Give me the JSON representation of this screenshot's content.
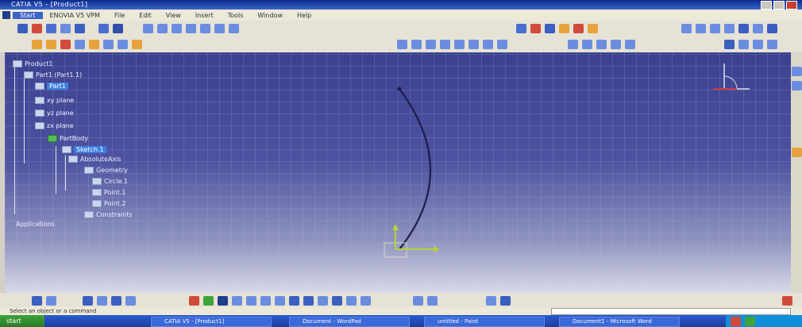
{
  "window": {
    "title": "CATIA V5 - [Product1]"
  },
  "menu": [
    "Start",
    "ENOVIA V5 VPM",
    "File",
    "Edit",
    "View",
    "Insert",
    "Tools",
    "Window",
    "Help"
  ],
  "tree": [
    {
      "label": "Product1",
      "icon": "product-icon"
    },
    {
      "label": "Part1 (Part1.1)",
      "icon": "part-icon"
    },
    {
      "label": "Part1",
      "icon": "part-icon",
      "selected": true
    },
    {
      "label": "xy plane",
      "icon": "plane-icon"
    },
    {
      "label": "yz plane",
      "icon": "plane-icon"
    },
    {
      "label": "zx plane",
      "icon": "plane-icon"
    },
    {
      "label": "PartBody",
      "icon": "body-icon"
    },
    {
      "label": "Sketch.1",
      "icon": "sketch-icon",
      "selected": true
    },
    {
      "label": "AbsoluteAxis",
      "icon": "axis-icon"
    },
    {
      "label": "Geometry",
      "icon": "geometry-icon"
    },
    {
      "label": "Circle.1",
      "icon": "circle-icon"
    },
    {
      "label": "Point.1",
      "icon": "point-icon"
    },
    {
      "label": "Point.2",
      "icon": "point-icon"
    },
    {
      "label": "Constraints",
      "icon": "constraints-icon"
    },
    {
      "label": "Applications",
      "icon": "applications-icon"
    }
  ],
  "status": {
    "message": "Select an object or a command"
  },
  "taskbar": {
    "start": "start",
    "tasks": [
      "CATIA V5 - [Product1]",
      "Document - WordPad",
      "untitled - Paint",
      "Document1 - Microsoft Word"
    ]
  },
  "colors": {
    "viewport_top": "#3b4190",
    "viewport_bottom": "#d9dae7",
    "curve": "#1c1f4d",
    "tree_selected": "#3e7fe0"
  }
}
